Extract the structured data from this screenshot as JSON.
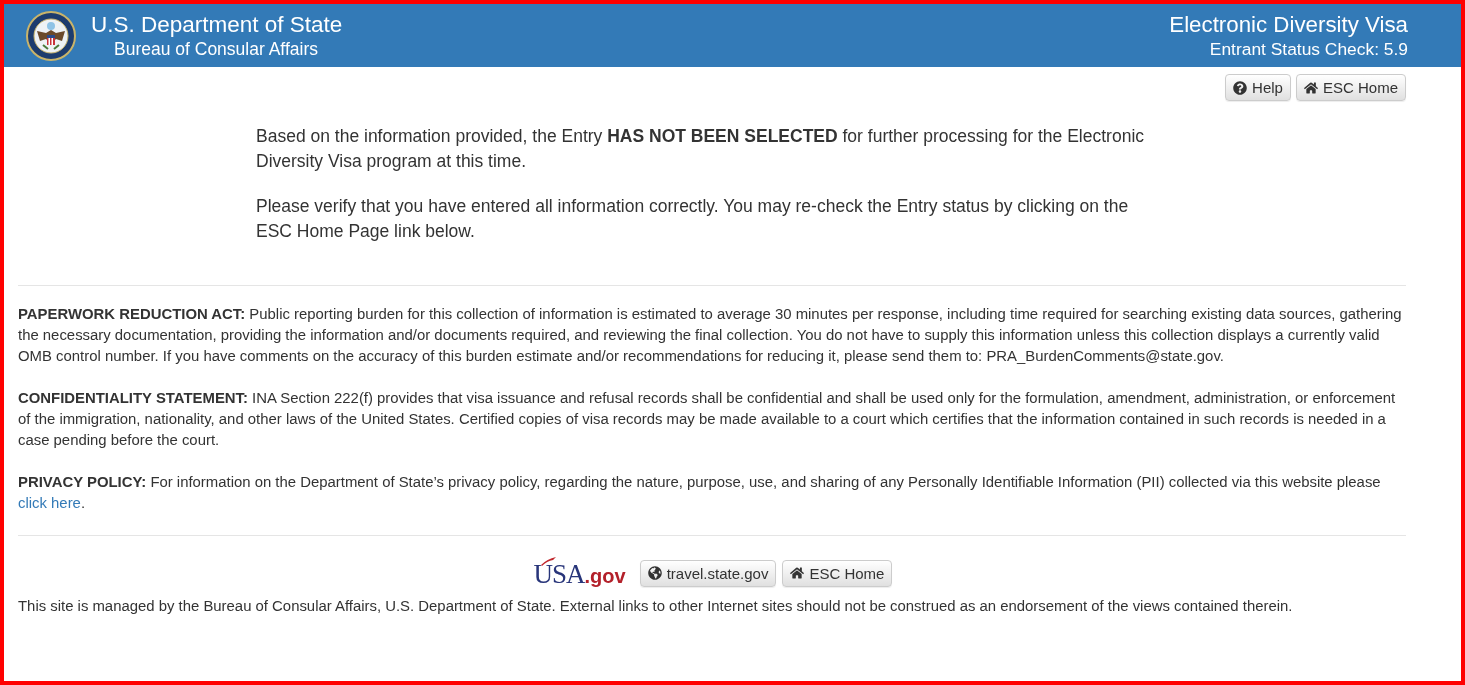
{
  "header": {
    "title": "U.S. Department of State",
    "subtitle": "Bureau of Consular Affairs",
    "app_title": "Electronic Diversity Visa",
    "app_subtitle": "Entrant Status Check: 5.9"
  },
  "top_buttons": [
    {
      "kind": "help",
      "label": "Help"
    },
    {
      "kind": "home",
      "label": "ESC Home"
    }
  ],
  "message": [
    "Based on the information provided, the Entry **HAS NOT BEEN SELECTED** for further processing for the Electronic Diversity Visa program at this time.",
    "Please verify that you have entered all information correctly. You may re-check the Entry status by clicking on the ESC Home Page link below."
  ],
  "notices": [
    {
      "text": "**PAPERWORK REDUCTION ACT:** Public reporting burden for this collection of information is estimated to average 30 minutes per response, including time required for searching existing data sources, gathering the necessary documentation, providing the information and/or documents required, and reviewing the final collection. You do not have to supply this information unless this collection displays a currently valid OMB control number. If you have comments on the accuracy of this burden estimate and/or recommendations for reducing it, please send them to: PRA_BurdenComments@state.gov."
    },
    {
      "text": "**CONFIDENTIALITY STATEMENT:** INA Section 222(f) provides that visa issuance and refusal records shall be confidential and shall be used only for the formulation, amendment, administration, or enforcement of the immigration, nationality, and other laws of the United States. Certified copies of visa records may be made available to a court which certifies that the information contained in such records is needed in a case pending before the court."
    },
    {
      "text": "**PRIVACY POLICY:** For information on the Department of State’s privacy policy, regarding the nature, purpose, use, and sharing of any Personally Identifiable Information (PII) collected via this website please",
      "link": "click here",
      "after": "."
    }
  ],
  "footer": {
    "logo": {
      "name": "USA",
      "domain": ".gov"
    },
    "buttons": [
      {
        "kind": "globe",
        "label": "travel.state.gov"
      },
      {
        "kind": "home",
        "label": "ESC Home"
      }
    ],
    "note": "This site is managed by the Bureau of Consular Affairs, U.S. Department of State. External links to other Internet sites should not be construed as an endorsement of the views contained therein."
  }
}
